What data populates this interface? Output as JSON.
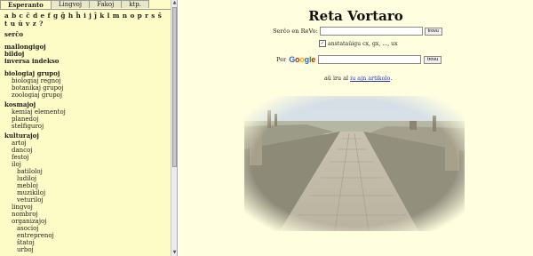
{
  "tabs": [
    {
      "label": "Esperanto",
      "active": true
    },
    {
      "label": "Lingvoj",
      "active": false
    },
    {
      "label": "Fakoj",
      "active": false
    },
    {
      "label": "ktp.",
      "active": false
    }
  ],
  "alphabet": "a b c ĉ d e f g ĝ h ĥ i j ĵ k l m n o p r s ŝ t u ŭ v z ?",
  "left_sections": {
    "serco": "serĉo",
    "links": [
      "mallongigoj",
      "bildoj",
      "inversa indekso"
    ],
    "groups_title": "biologiaj grupoj",
    "groups": [
      "biologiaj regnoj",
      "botanikaj grupoj",
      "zoologiaj grupoj"
    ],
    "kosmo_title": "kosmajoj",
    "kosmo": [
      "kemiaj elementoj",
      "planedoj",
      "stelfiguroj"
    ],
    "kultur_title": "kulturajoj",
    "kultur": [
      "artoj",
      "dancoj",
      "festoj",
      "iloj"
    ],
    "iloj_sub": [
      "batiloloj",
      "ludiloj",
      "mebloj",
      "muzikiloj",
      "veturiloj"
    ],
    "kultur2": [
      "lingvoj",
      "nombroj",
      "organizajoj"
    ],
    "org_sub": [
      "asocioj",
      "entreprenoj",
      "ŝtatoj",
      "urboj"
    ]
  },
  "main": {
    "title": "Reta Vortaro",
    "search_label": "Serĉo en ReVo:",
    "search_value": "",
    "search_button": "trovu",
    "checkbox_label": "anstataŭigu  cx, gx, ..., ux",
    "checkbox_checked": true,
    "per_label": "Per",
    "google_letters": [
      "G",
      "o",
      "o",
      "g",
      "l",
      "e"
    ],
    "google_colors": [
      "#3366cc",
      "#cc2200",
      "#ffaa00",
      "#3366cc",
      "#229922",
      "#cc2200"
    ],
    "google_button": "trovu",
    "random_prefix": "aŭ iru al",
    "random_link": "iu ajn artikolo",
    "random_suffix": "."
  },
  "colors": {
    "left_bg": "#fdfcc7",
    "right_bg": "#ffffe0",
    "link": "#2233cc"
  }
}
